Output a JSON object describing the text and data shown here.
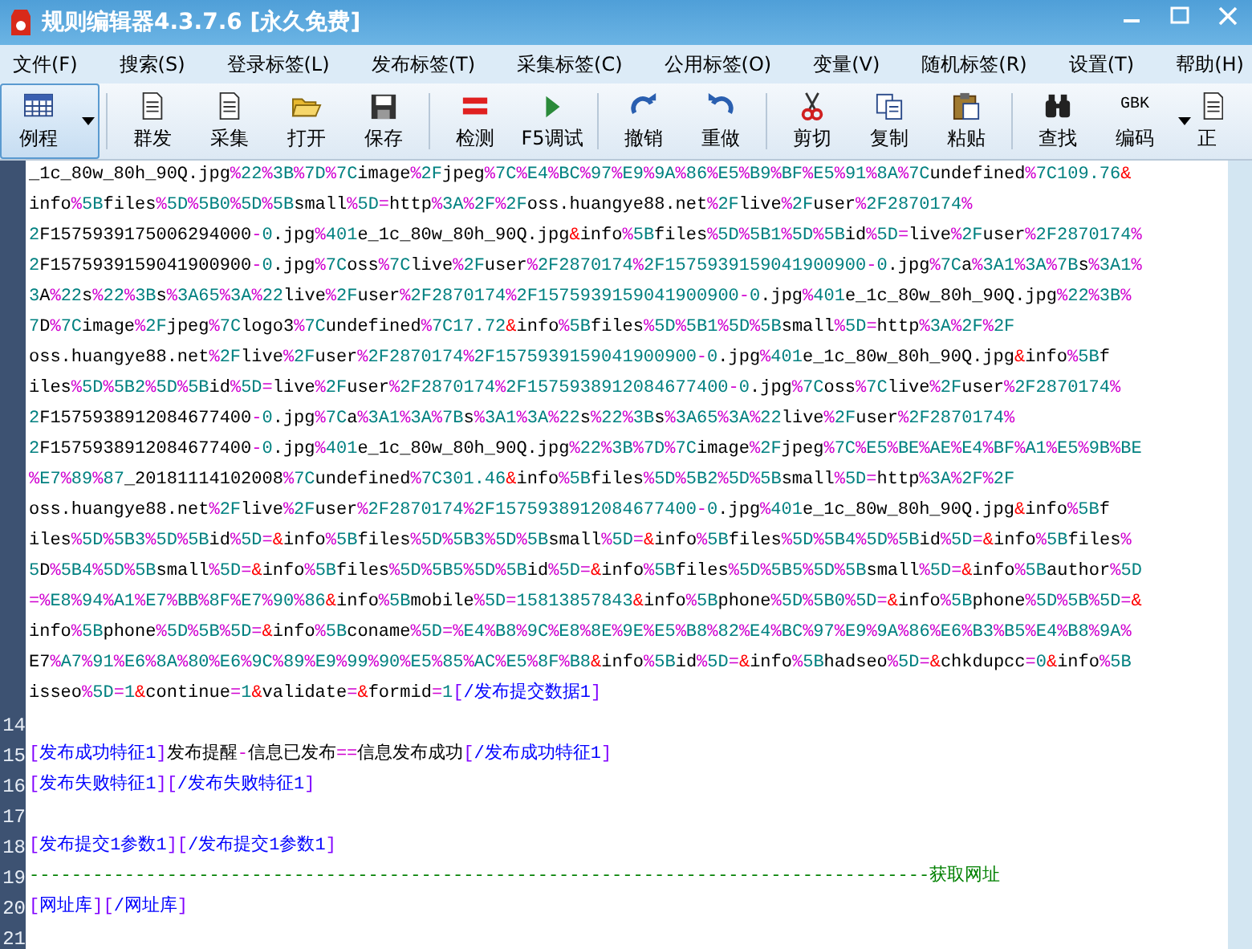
{
  "window": {
    "title": "规则编辑器4.3.7.6 [永久免费]"
  },
  "menu": [
    "文件(F)",
    "搜索(S)",
    "登录标签(L)",
    "发布标签(T)",
    "采集标签(C)",
    "公用标签(O)",
    "变量(V)",
    "随机标签(R)",
    "设置(T)",
    "帮助(H)"
  ],
  "toolbar": [
    {
      "kind": "button",
      "label": "例程",
      "selected": true,
      "dropdown": true
    },
    {
      "kind": "separator"
    },
    {
      "kind": "button",
      "label": "群发",
      "selected": false,
      "dropdown": false
    },
    {
      "kind": "button",
      "label": "采集",
      "selected": false,
      "dropdown": false
    },
    {
      "kind": "button",
      "label": "打开",
      "selected": false,
      "dropdown": false
    },
    {
      "kind": "button",
      "label": "保存",
      "selected": false,
      "dropdown": false
    },
    {
      "kind": "separator"
    },
    {
      "kind": "button",
      "label": "检测",
      "selected": false,
      "dropdown": false
    },
    {
      "kind": "button",
      "label": "F5调试",
      "selected": false,
      "dropdown": false
    },
    {
      "kind": "separator"
    },
    {
      "kind": "button",
      "label": "撤销",
      "selected": false,
      "dropdown": false
    },
    {
      "kind": "button",
      "label": "重做",
      "selected": false,
      "dropdown": false
    },
    {
      "kind": "separator"
    },
    {
      "kind": "button",
      "label": "剪切",
      "selected": false,
      "dropdown": false
    },
    {
      "kind": "button",
      "label": "复制",
      "selected": false,
      "dropdown": false
    },
    {
      "kind": "button",
      "label": "粘贴",
      "selected": false,
      "dropdown": false
    },
    {
      "kind": "separator"
    },
    {
      "kind": "button",
      "label": "查找",
      "selected": false,
      "dropdown": false
    },
    {
      "kind": "button",
      "label": "编码",
      "icon_text": "GBK",
      "selected": false,
      "dropdown": true
    },
    {
      "kind": "button",
      "label": "正",
      "selected": false,
      "dropdown": false
    }
  ],
  "editor": {
    "rows": [
      {
        "kind": "code",
        "text": "_1c_80w_80h_90Q.jpg%22%3B%7D%7Cimage%2Fjpeg%7C%E4%BC%97%E9%9A%86%E5%B9%BF%E5%91%8A%7Cundefined%7C109.76&"
      },
      {
        "kind": "code",
        "text": "info%5Bfiles%5D%5B0%5D%5Bsmall%5D=http%3A%2F%2Foss.huangye88.net%2Flive%2Fuser%2F2870174%"
      },
      {
        "kind": "code",
        "text": "2F1575939175006294000-0.jpg%401e_1c_80w_80h_90Q.jpg&info%5Bfiles%5D%5B1%5D%5Bid%5D=live%2Fuser%2F2870174%"
      },
      {
        "kind": "code",
        "text": "2F1575939159041900900-0.jpg%7Coss%7Clive%2Fuser%2F2870174%2F1575939159041900900-0.jpg%7Ca%3A1%3A%7Bs%3A1%"
      },
      {
        "kind": "code",
        "text": "3A%22s%22%3Bs%3A65%3A%22live%2Fuser%2F2870174%2F1575939159041900900-0.jpg%401e_1c_80w_80h_90Q.jpg%22%3B%"
      },
      {
        "kind": "code",
        "text": "7D%7Cimage%2Fjpeg%7Clogo3%7Cundefined%7C17.72&info%5Bfiles%5D%5B1%5D%5Bsmall%5D=http%3A%2F%2F"
      },
      {
        "kind": "code",
        "text": "oss.huangye88.net%2Flive%2Fuser%2F2870174%2F1575939159041900900-0.jpg%401e_1c_80w_80h_90Q.jpg&info%5Bf"
      },
      {
        "kind": "code",
        "text": "iles%5D%5B2%5D%5Bid%5D=live%2Fuser%2F2870174%2F1575938912084677400-0.jpg%7Coss%7Clive%2Fuser%2F2870174%"
      },
      {
        "kind": "code",
        "text": "2F1575938912084677400-0.jpg%7Ca%3A1%3A%7Bs%3A1%3A%22s%22%3Bs%3A65%3A%22live%2Fuser%2F2870174%"
      },
      {
        "kind": "code",
        "text": "2F1575938912084677400-0.jpg%401e_1c_80w_80h_90Q.jpg%22%3B%7D%7Cimage%2Fjpeg%7C%E5%BE%AE%E4%BF%A1%E5%9B%BE"
      },
      {
        "kind": "code",
        "text": "%E7%89%87_20181114102008%7Cundefined%7C301.46&info%5Bfiles%5D%5B2%5D%5Bsmall%5D=http%3A%2F%2F"
      },
      {
        "kind": "code",
        "text": "oss.huangye88.net%2Flive%2Fuser%2F2870174%2F1575938912084677400-0.jpg%401e_1c_80w_80h_90Q.jpg&info%5Bf"
      },
      {
        "kind": "code",
        "text": "iles%5D%5B3%5D%5Bid%5D=&info%5Bfiles%5D%5B3%5D%5Bsmall%5D=&info%5Bfiles%5D%5B4%5D%5Bid%5D=&info%5Bfiles%"
      },
      {
        "kind": "code",
        "text": "5D%5B4%5D%5Bsmall%5D=&info%5Bfiles%5D%5B5%5D%5Bid%5D=&info%5Bfiles%5D%5B5%5D%5Bsmall%5D=&info%5Bauthor%5D"
      },
      {
        "kind": "code",
        "text": "=%E8%94%A1%E7%BB%8F%E7%90%86&info%5Bmobile%5D=15813857843&info%5Bphone%5D%5B0%5D=&info%5Bphone%5D%5B%5D=&"
      },
      {
        "kind": "code",
        "text": "info%5Bphone%5D%5B%5D=&info%5Bconame%5D=%E4%B8%9C%E8%8E%9E%E5%B8%82%E4%BC%97%E9%9A%86%E6%B3%B5%E4%B8%9A%"
      },
      {
        "kind": "code",
        "text": "E7%A7%91%E6%8A%80%E6%9C%89%E9%99%90%E5%85%AC%E5%8F%B8&info%5Bid%5D=&info%5Bhadseo%5D=&chkdupcc=0&info%5B"
      },
      {
        "kind": "code",
        "text": "isseo%5D=1&continue=1&validate=&formid=1[/发布提交数据1]"
      },
      {
        "number": "14",
        "text": ""
      },
      {
        "kind": "code",
        "number": "15",
        "text": "[发布成功特征1]发布提醒-信息已发布==信息发布成功[/发布成功特征1]"
      },
      {
        "kind": "code",
        "number": "16",
        "text": "[发布失败特征1][/发布失败特征1]"
      },
      {
        "number": "17",
        "text": ""
      },
      {
        "kind": "code",
        "number": "18",
        "text": "[发布提交1参数1][/发布提交1参数1]"
      },
      {
        "kind": "comment",
        "number": "19",
        "text": "-------------------------------------------------------------------------------------获取网址"
      },
      {
        "kind": "code",
        "number": "20",
        "text": "[网址库][/网址库]"
      },
      {
        "number": "21",
        "text": ""
      }
    ]
  }
}
